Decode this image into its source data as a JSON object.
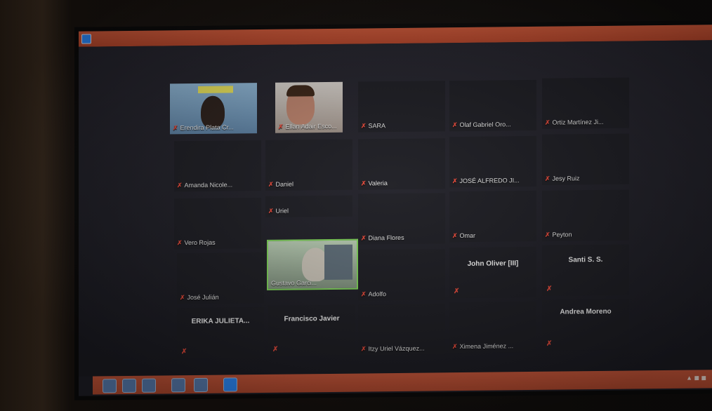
{
  "participants": [
    {
      "name": "Erendira Plata Cr...",
      "muted": true
    },
    {
      "name": "Ellan Adair Esco...",
      "muted": true
    },
    {
      "name": "SARA",
      "muted": true
    },
    {
      "name": "Olaf Gabriel Oro...",
      "muted": true
    },
    {
      "name": "Ortiz Martínez Ji...",
      "muted": true
    },
    {
      "name": "Amanda Nicole...",
      "muted": true
    },
    {
      "name": "Daniel",
      "muted": true
    },
    {
      "name": "Valeria",
      "muted": true
    },
    {
      "name": "JOSÉ ALFREDO JI...",
      "muted": true
    },
    {
      "name": "Jesy Ruiz",
      "muted": true
    },
    {
      "name": "Vero Rojas",
      "muted": true
    },
    {
      "name": "Uriel",
      "muted": true
    },
    {
      "name": "Diana Flores",
      "muted": true
    },
    {
      "name": "Omar",
      "muted": true
    },
    {
      "name": "Peyton",
      "muted": true
    },
    {
      "name": "José Julián",
      "muted": true
    },
    {
      "name": "Gustavo Garci...",
      "muted": false
    },
    {
      "name": "Adolfo",
      "muted": true
    },
    {
      "name": "John Oliver [III]",
      "muted": true
    },
    {
      "name": "Santi S. S.",
      "muted": true
    },
    {
      "name": "ERIKA JULIETA...",
      "muted": true
    },
    {
      "name": "Francisco Javier",
      "muted": true
    },
    {
      "name": "Itzy Uriel Vázquez...",
      "muted": true
    },
    {
      "name": "Ximena Jiménez ...",
      "muted": true
    },
    {
      "name": "Andrea Moreno",
      "muted": true
    }
  ],
  "icons": {
    "mic_muted": "✗",
    "app": "zoom-icon"
  },
  "colors": {
    "titlebar": "#c24e30",
    "mic_muted": "#e5493a",
    "active_speaker_border": "#7fd35a"
  }
}
